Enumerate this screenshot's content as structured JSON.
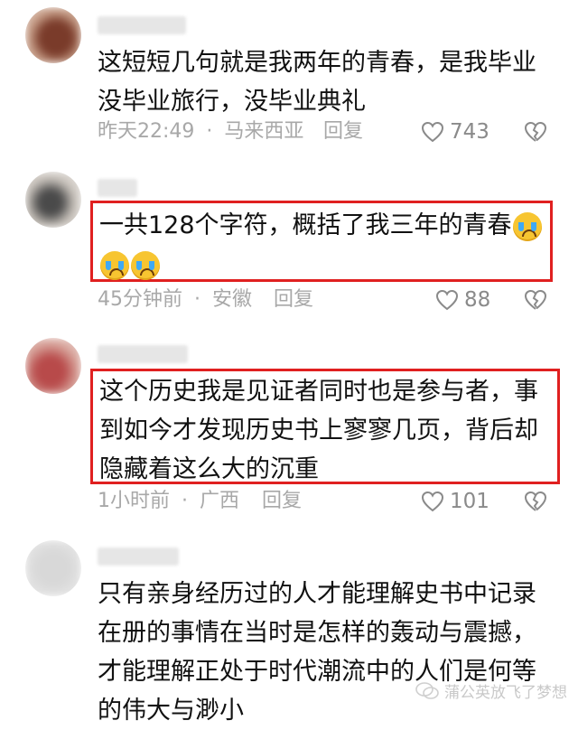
{
  "comments": [
    {
      "lines": [
        "这短短几句就是我两年的青春，是我毕业",
        "没毕业旅行，没毕业典礼"
      ],
      "time": "昨天22:49",
      "location": "马来西亚",
      "reply_label": "回复",
      "likes": "743",
      "highlighted": false
    },
    {
      "lines": [
        "一共128个字符，概括了我三年的青春",
        ""
      ],
      "time": "45分钟前",
      "location": "安徽",
      "reply_label": "回复",
      "likes": "88",
      "highlighted": true
    },
    {
      "lines": [
        "这个历史我是见证者同时也是参与者，事",
        "到如今才发现历史书上寥寥几页，背后却",
        "隐藏着这么大的沉重"
      ],
      "time": "1小时前",
      "location": "广西",
      "reply_label": "回复",
      "likes": "101",
      "highlighted": true
    },
    {
      "lines": [
        "只有亲身经历过的人才能理解史书中记录",
        "在册的事情在当时是怎样的轰动与震撼，",
        "才能理解正处于时代潮流中的人们是何等",
        "的伟大与渺小"
      ]
    }
  ],
  "separator": "·",
  "watermark": "蒲公英放飞了梦想",
  "icons": {
    "like": "heart-outline-icon",
    "dislike": "broken-heart-icon",
    "emoji": "crying-face-emoji"
  },
  "colors": {
    "highlight_border": "#e02020",
    "meta_text": "#a8a8a8"
  }
}
